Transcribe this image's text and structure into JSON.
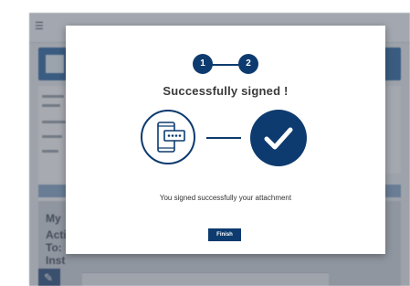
{
  "background_app": {
    "menu_icon": "hamburger-icon",
    "section_text": "My",
    "row_labels": [
      "Acti",
      "To:",
      "Inst"
    ],
    "edit_icon": "pencil-icon"
  },
  "modal": {
    "stepper": {
      "steps": [
        "1",
        "2"
      ],
      "current_step": 2
    },
    "title": "Successfully signed !",
    "icons": {
      "phone": "phone-with-code-icon",
      "check": "checkmark-icon"
    },
    "message": "You signed successfully your attachment",
    "finish_label": "Finish"
  },
  "colors": {
    "primary": "#0d3b6f",
    "overlay": "rgba(60,66,78,0.42)",
    "title_text": "#3a3a3a"
  }
}
